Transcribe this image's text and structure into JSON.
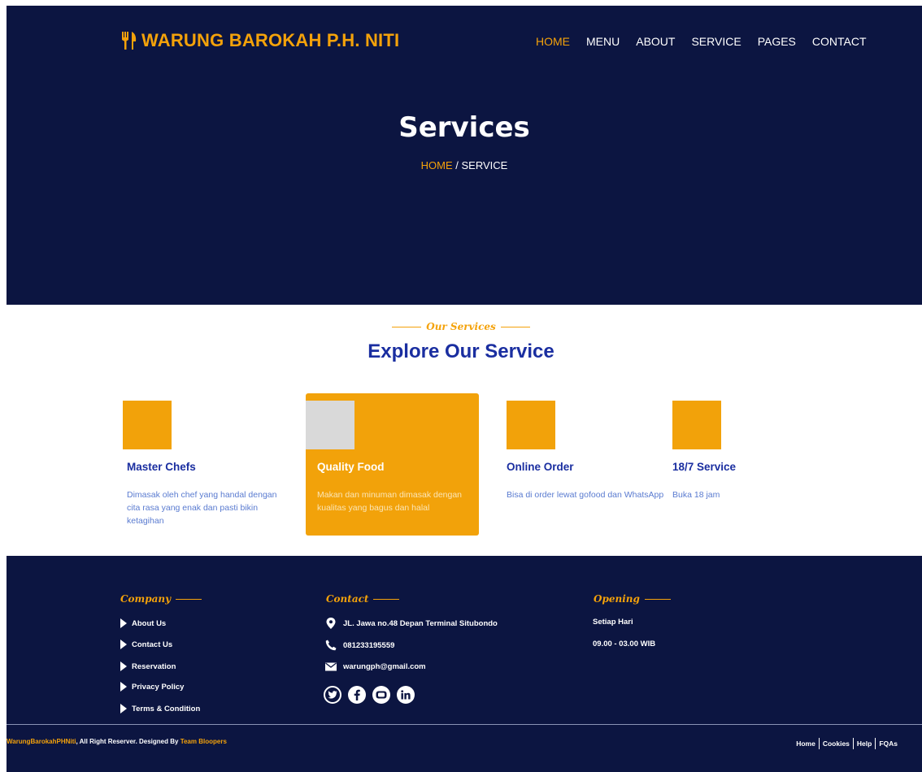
{
  "brand": {
    "name": "WARUNG BAROKAH P.H. NITI"
  },
  "nav": {
    "items": [
      {
        "label": "HOME"
      },
      {
        "label": "MENU"
      },
      {
        "label": "ABOUT"
      },
      {
        "label": "SERVICE"
      },
      {
        "label": "PAGES"
      },
      {
        "label": "CONTACT"
      }
    ],
    "active": "HOME"
  },
  "hero": {
    "title": "Services",
    "breadcrumb_home": "HOME",
    "breadcrumb_sep": " / ",
    "breadcrumb_current": "SERVICE"
  },
  "services": {
    "eyebrow": "Our Services",
    "title": "Explore Our Service",
    "cards": [
      {
        "title": "Master Chefs",
        "text": "Dimasak oleh chef yang handal dengan cita rasa yang enak dan pasti bikin ketagihan"
      },
      {
        "title": "Quality Food",
        "text": "Makan dan minuman dimasak dengan kualitas yang bagus dan halal"
      },
      {
        "title": "Online Order",
        "text": "Bisa di order lewat gofood dan WhatsApp"
      },
      {
        "title": "18/7 Service",
        "text": "Buka 18 jam"
      }
    ]
  },
  "footer": {
    "company_head": "Company",
    "company_links": [
      "About Us",
      "Contact Us",
      "Reservation",
      "Privacy Policy",
      "Terms & Condition"
    ],
    "contact_head": "Contact",
    "address": "JL. Jawa no.48 Depan Terminal Situbondo",
    "phone": "081233195559",
    "email": "warungph@gmail.com",
    "opening_head": "Opening",
    "opening_days": "Setiap Hari",
    "opening_hours": "09.00 - 03.00 WIB",
    "copyright_brand": "WarungBarokahPHNiti",
    "copyright_text": ", All Right Reserver. Designed By ",
    "copyright_designer": "Team Bloopers",
    "bottom_links": [
      "Home",
      "Cookies",
      "Help",
      "FQAs"
    ]
  },
  "colors": {
    "navy": "#0c1541",
    "accent": "#f4a20a",
    "heading_blue": "#1a2ea0"
  }
}
